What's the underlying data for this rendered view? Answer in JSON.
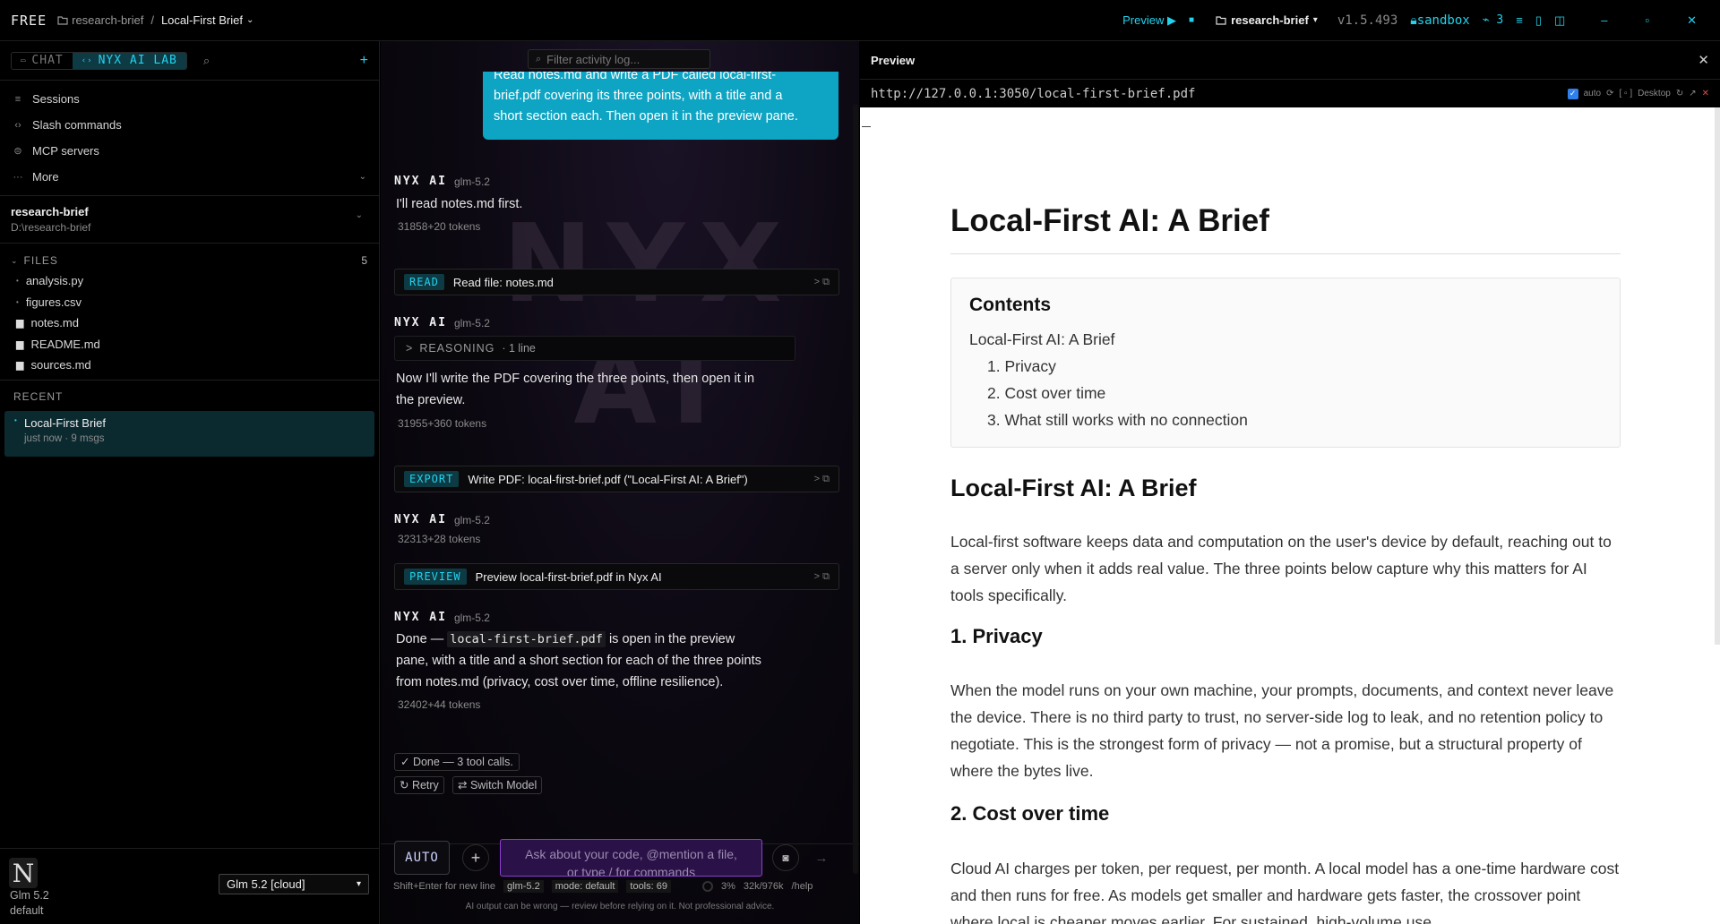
{
  "topbar": {
    "plan": "FREE",
    "project": "research-brief",
    "separator": "/",
    "session": "Local-First Brief",
    "preview_label": "Preview",
    "workspace": "research-brief",
    "version": "v1.5.493",
    "sandbox": "sandbox",
    "activity_count": "3"
  },
  "sidebar": {
    "tabs": [
      {
        "label": "CHAT"
      },
      {
        "label": "NYX AI LAB"
      }
    ],
    "nav": [
      {
        "label": "Sessions",
        "icon": "list-icon"
      },
      {
        "label": "Slash commands",
        "icon": "code-icon"
      },
      {
        "label": "MCP servers",
        "icon": "server-icon"
      },
      {
        "label": "More",
        "icon": "ellipsis-icon"
      }
    ],
    "project": {
      "name": "research-brief",
      "path": "D:\\research-brief"
    },
    "files_header": "FILES",
    "files_count": "5",
    "files": [
      {
        "name": "analysis.py",
        "icon": "dot-icon"
      },
      {
        "name": "figures.csv",
        "icon": "dot-icon"
      },
      {
        "name": "notes.md",
        "icon": "file-icon"
      },
      {
        "name": "README.md",
        "icon": "file-icon"
      },
      {
        "name": "sources.md",
        "icon": "file-icon"
      }
    ],
    "recent_header": "RECENT",
    "recent": [
      {
        "title": "Local-First Brief",
        "meta": "just now · 9 msgs"
      }
    ],
    "footer": {
      "logo_letter": "N",
      "model_name": "Glm 5.2",
      "model_mode": "default",
      "model_select": "Glm 5.2 [cloud]"
    }
  },
  "chat": {
    "filter_placeholder": "Filter activity log...",
    "user_msg_lines": [
      "Read notes.md and write a PDF called local-first-",
      "brief.pdf covering its three points, with a title and a",
      "short section each. Then open it in the preview pane."
    ],
    "watermark_top": "NYX",
    "watermark_bottom": "AI",
    "assistant_name": "NYX AI",
    "model": "glm-5.2",
    "m1_text": "I'll read notes.md first.",
    "m1_tokens": "31858+20 tokens",
    "tool1_tag": "READ",
    "tool1_text": "Read file: notes.md",
    "reasoning_label": "REASONING",
    "reasoning_meta": "· 1 line",
    "m2_lines": [
      "Now I'll write the PDF covering the three points, then open it in",
      "the preview."
    ],
    "m2_tokens": "31955+360 tokens",
    "tool2_tag": "EXPORT",
    "tool2_text": "Write PDF: local-first-brief.pdf (\"Local-First AI: A Brief\")",
    "m3_tokens": "32313+28 tokens",
    "tool3_tag": "PREVIEW",
    "tool3_text": "Preview local-first-brief.pdf in Nyx AI",
    "m4_pre": "Done — ",
    "m4_code": "local-first-brief.pdf",
    "m4_post": " is open in the preview",
    "m4_lines": [
      "pane, with a title and a short section for each of the three points",
      "from notes.md (privacy, cost over time, offline resilience)."
    ],
    "m4_tokens": "32402+44 tokens",
    "done_badge": "✓ Done — 3 tool calls.",
    "retry": "↻ Retry",
    "switch_model": "⇄ Switch Model",
    "auto_label": "AUTO",
    "input_placeholder": "Ask about your code, @mention a file, or type / for commands",
    "hint_newline": "Shift+Enter for new line",
    "status_model": "glm-5.2",
    "status_mode": "mode: default",
    "status_tools": "tools: 69",
    "context_pct": "3%",
    "context_tokens": "32k/976k",
    "help": "/help",
    "disclaimer": "AI output can be wrong — review before relying on it. Not professional advice."
  },
  "preview": {
    "title": "Preview",
    "url": "http://127.0.0.1:3050/local-first-brief.pdf",
    "auto_label": "auto",
    "device": "Desktop",
    "doc": {
      "h1": "Local-First AI: A Brief",
      "contents_title": "Contents",
      "toc": [
        "Local-First AI: A Brief",
        "1. Privacy",
        "2. Cost over time",
        "3. What still works with no connection"
      ],
      "h2": "Local-First AI: A Brief",
      "intro": "Local-first software keeps data and computation on the user's device by default, reaching out to a server only when it adds real value. The three points below capture why this matters for AI tools specifically.",
      "s1_title": "1. Privacy",
      "s1_text": "When the model runs on your own machine, your prompts, documents, and context never leave the device. There is no third party to trust, no server-side log to leak, and no retention policy to negotiate. This is the strongest form of privacy — not a promise, but a structural property of where the bytes live.",
      "s2_title": "2. Cost over time",
      "s2_text": "Cloud AI charges per token, per request, per month. A local model has a one-time hardware cost and then runs for free. As models get smaller and hardware gets faster, the crossover point where local is cheaper moves earlier. For sustained, high-volume use"
    }
  }
}
